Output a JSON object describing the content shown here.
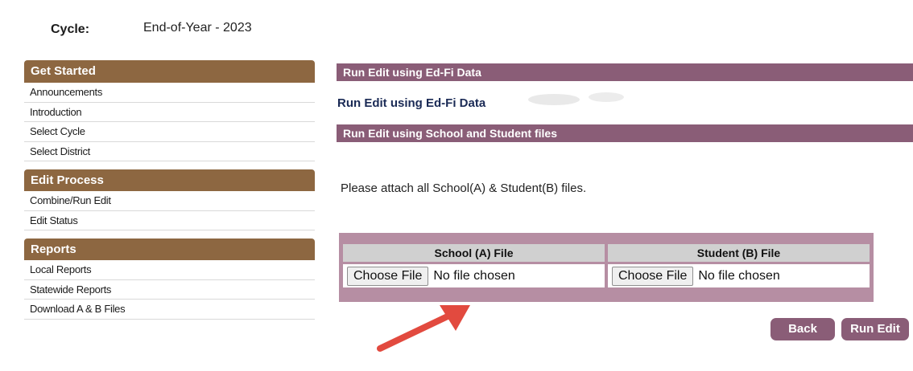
{
  "cycle": {
    "label": "Cycle:",
    "value": "End-of-Year - 2023"
  },
  "sidebar": {
    "sections": [
      {
        "title": "Get Started",
        "items": [
          "Announcements",
          "Introduction",
          "Select Cycle",
          "Select District"
        ]
      },
      {
        "title": "Edit Process",
        "items": [
          "Combine/Run Edit",
          "Edit Status"
        ]
      },
      {
        "title": "Reports",
        "items": [
          "Local Reports",
          "Statewide Reports",
          "Download A & B Files"
        ]
      }
    ]
  },
  "main": {
    "edfi_bar": "Run Edit using Ed-Fi Data",
    "edfi_link": "Run Edit using Ed-Fi Data",
    "files_bar": "Run Edit using School and Student files",
    "instructions": "Please attach all School(A) & Student(B) files."
  },
  "upload": {
    "school": {
      "header": "School (A) File",
      "button": "Choose File",
      "status": "No file chosen"
    },
    "student": {
      "header": "Student (B) File",
      "button": "Choose File",
      "status": "No file chosen"
    }
  },
  "buttons": {
    "back": "Back",
    "run_edit": "Run Edit"
  },
  "colors": {
    "sidebar_header": "#8d6741",
    "main_bar": "#8a5d77",
    "upload_panel": "#b68ea3",
    "arrow": "#e24a3f"
  }
}
